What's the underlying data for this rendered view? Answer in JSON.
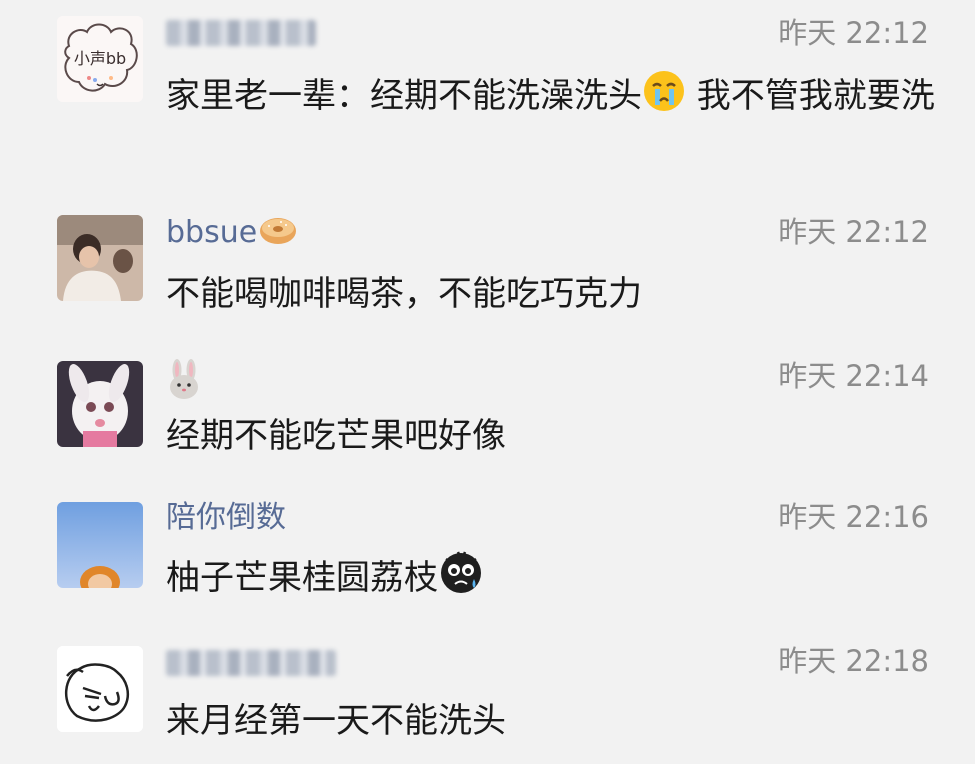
{
  "comments": [
    {
      "username": "",
      "time": "昨天 22:12",
      "text_before": "家里老一辈：经期不能洗澡洗头",
      "text_after": " 我不管我就要洗",
      "avatar_text": "小声bb",
      "emoji": "crying-face-emoji"
    },
    {
      "username": "bbsue",
      "time": "昨天 22:12",
      "text": "不能喝咖啡喝茶，不能吃巧克力",
      "name_emoji": "bagel-emoji"
    },
    {
      "username": "",
      "time": "昨天 22:14",
      "text": "经期不能吃芒果吧好像",
      "name_emoji": "rabbit-emoji"
    },
    {
      "username": "陪你倒数",
      "time": "昨天 22:16",
      "text": "柚子芒果桂圆荔枝",
      "emoji": "sad-face-emoji"
    },
    {
      "username": "",
      "time": "昨天 22:18",
      "text": "来月经第一天不能洗头"
    }
  ],
  "colors": {
    "background": "#f2f2f2",
    "username": "#576b95",
    "time": "#8c8c8c",
    "text": "#1a1a1a"
  }
}
